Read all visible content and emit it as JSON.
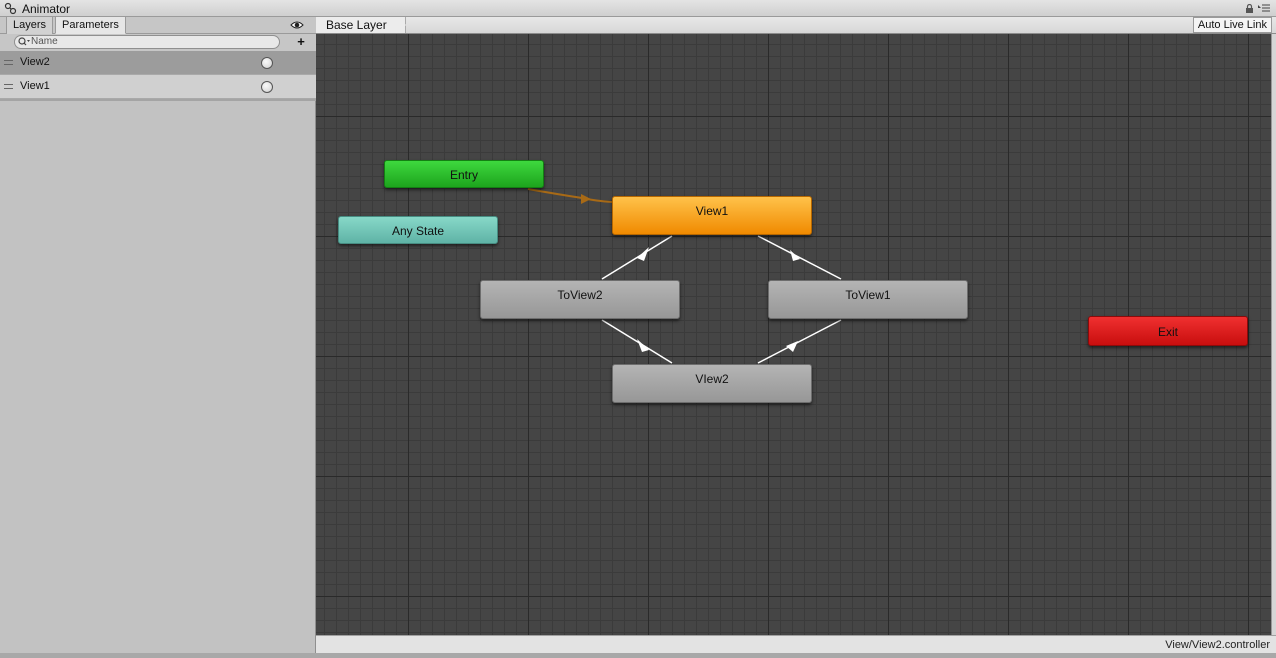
{
  "window": {
    "title": "Animator",
    "icons": [
      "animator-icon",
      "lock-icon",
      "panel-menu-icon"
    ]
  },
  "left_panel": {
    "tabs": [
      {
        "label": "Layers",
        "active": false
      },
      {
        "label": "Parameters",
        "active": true
      }
    ],
    "search": {
      "placeholder": "Name",
      "value": ""
    },
    "add_label": "+",
    "parameters": [
      {
        "name": "View2",
        "type": "trigger",
        "selected": true
      },
      {
        "name": "View1",
        "type": "trigger",
        "selected": false
      }
    ]
  },
  "graph": {
    "breadcrumb": "Base Layer",
    "live_link_label": "Auto Live Link",
    "states": {
      "entry": "Entry",
      "any_state": "Any State",
      "view1": "View1",
      "toview2": "ToView2",
      "toview1": "ToView1",
      "view2": "VIew2",
      "exit": "Exit"
    },
    "default_state": "View1",
    "colors": {
      "entry": "#2cc02c",
      "any_state": "#6fc4b6",
      "default_state": "#f7a21d",
      "state": "#a6a6a6",
      "exit": "#dc1f1f",
      "default_transition": "#a86a16",
      "transition": "#ffffff",
      "background": "#454545"
    }
  },
  "status": {
    "path": "View/View2.controller"
  }
}
